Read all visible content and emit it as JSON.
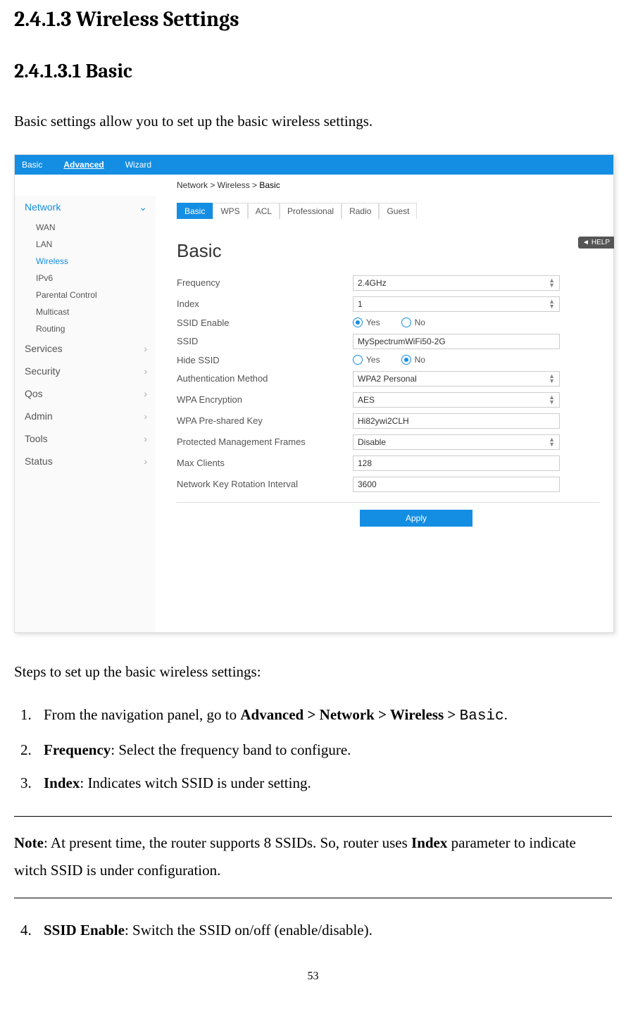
{
  "heading1": "2.4.1.3 Wireless Settings",
  "heading2": "2.4.1.3.1 Basic",
  "intro": "Basic settings allow you to set up the basic wireless settings.",
  "topnav": {
    "basic": "Basic",
    "advanced": "Advanced",
    "wizard": "Wizard"
  },
  "breadcrumb": {
    "full": "Network > Wireless > ",
    "last": "Basic"
  },
  "sidebar": {
    "network": "Network",
    "subs": {
      "wan": "WAN",
      "lan": "LAN",
      "wireless": "Wireless",
      "ipv6": "IPv6",
      "parental": "Parental Control",
      "multicast": "Multicast",
      "routing": "Routing"
    },
    "services": "Services",
    "security": "Security",
    "qos": "Qos",
    "admin": "Admin",
    "tools": "Tools",
    "status": "Status"
  },
  "tabs": {
    "basic": "Basic",
    "wps": "WPS",
    "acl": "ACL",
    "professional": "Professional",
    "radio": "Radio",
    "guest": "Guest"
  },
  "panel_title": "Basic",
  "help": "HELP",
  "form": {
    "frequency_label": "Frequency",
    "frequency_value": "2.4GHz",
    "index_label": "Index",
    "index_value": "1",
    "ssid_enable_label": "SSID Enable",
    "yes": "Yes",
    "no": "No",
    "ssid_label": "SSID",
    "ssid_value": "MySpectrumWiFi50-2G",
    "hide_ssid_label": "Hide SSID",
    "auth_label": "Authentication Method",
    "auth_value": "WPA2 Personal",
    "wpa_enc_label": "WPA Encryption",
    "wpa_enc_value": "AES",
    "psk_label": "WPA Pre-shared Key",
    "psk_value": "Hi82ywi2CLH",
    "pmf_label": "Protected Management Frames",
    "pmf_value": "Disable",
    "max_label": "Max Clients",
    "max_value": "128",
    "rot_label": "Network Key Rotation Interval",
    "rot_value": "3600"
  },
  "apply": "Apply",
  "steps_intro": "Steps to set up the basic wireless settings:",
  "step1_a": "From the navigation panel, go to ",
  "step1_b": "Advanced > Network > Wireless > ",
  "step1_c": "Basic",
  "step2_a": "Frequency",
  "step2_b": ": Select the frequency band to configure.",
  "step3_a": "Index",
  "step3_b": ": Indicates witch SSID is under setting.",
  "note_a": "Note",
  "note_b": ": At present time, the router supports 8 SSIDs. So, router uses ",
  "note_c": "Index",
  "note_d": " parameter to indicate witch SSID is under configuration.",
  "step4_a": "SSID Enable",
  "step4_b": ": Switch the SSID on/off (enable/disable).",
  "page_num": "53"
}
